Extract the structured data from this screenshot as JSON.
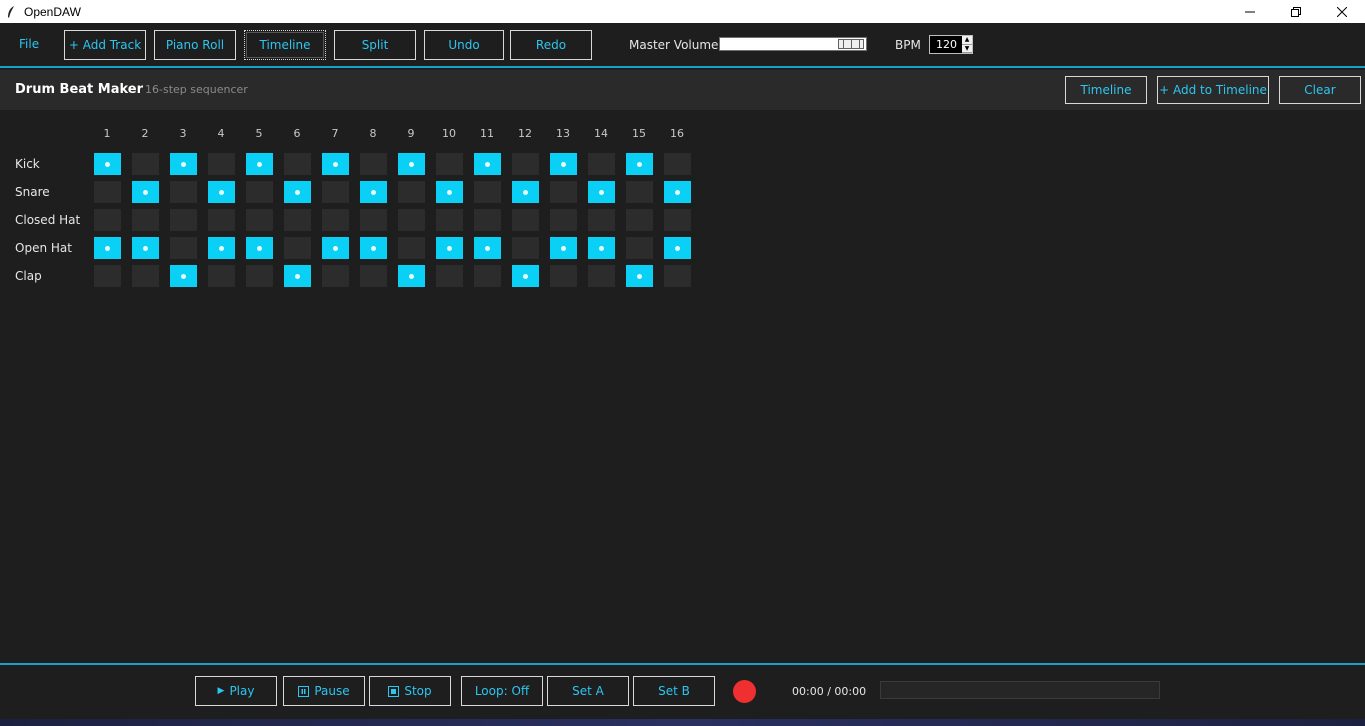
{
  "window": {
    "title": "OpenDAW",
    "app_icon": "feather-icon"
  },
  "toolbar": {
    "file_label": "File",
    "add_track_label": "+ Add Track",
    "piano_roll_label": "Piano Roll",
    "timeline_label": "Timeline",
    "split_label": "Split",
    "undo_label": "Undo",
    "redo_label": "Redo",
    "master_volume_label": "Master Volume",
    "master_volume_value": 0.87,
    "bpm_label": "BPM",
    "bpm_value": "120"
  },
  "header": {
    "title": "Drum Beat Maker",
    "subtitle": "16-step sequencer",
    "timeline_button": "Timeline",
    "add_to_timeline_button": "+ Add to Timeline",
    "clear_button": "Clear"
  },
  "sequencer": {
    "steps": [
      "1",
      "2",
      "3",
      "4",
      "5",
      "6",
      "7",
      "8",
      "9",
      "10",
      "11",
      "12",
      "13",
      "14",
      "15",
      "16"
    ],
    "rows": [
      {
        "name": "Kick",
        "pattern": [
          1,
          0,
          1,
          0,
          1,
          0,
          1,
          0,
          1,
          0,
          1,
          0,
          1,
          0,
          1,
          0
        ]
      },
      {
        "name": "Snare",
        "pattern": [
          0,
          1,
          0,
          1,
          0,
          1,
          0,
          1,
          0,
          1,
          0,
          1,
          0,
          1,
          0,
          1
        ]
      },
      {
        "name": "Closed Hat",
        "pattern": [
          0,
          0,
          0,
          0,
          0,
          0,
          0,
          0,
          0,
          0,
          0,
          0,
          0,
          0,
          0,
          0
        ]
      },
      {
        "name": "Open Hat",
        "pattern": [
          1,
          1,
          0,
          1,
          1,
          0,
          1,
          1,
          0,
          1,
          1,
          0,
          1,
          1,
          0,
          1
        ]
      },
      {
        "name": "Clap",
        "pattern": [
          0,
          0,
          1,
          0,
          0,
          1,
          0,
          0,
          1,
          0,
          0,
          1,
          0,
          0,
          1,
          0
        ]
      }
    ],
    "active_color": "#0bd0f5",
    "inactive_color": "#2c2c2c"
  },
  "transport": {
    "play_label": "Play",
    "pause_label": "Pause",
    "stop_label": "Stop",
    "loop_label": "Loop: Off",
    "set_a_label": "Set A",
    "set_b_label": "Set B",
    "record_color": "#f03030",
    "time_display": "00:00 / 00:00",
    "progress": 0
  },
  "colors": {
    "accent": "#2cc6f0",
    "divider": "#1aa0c0",
    "background": "#1e1e1e"
  }
}
